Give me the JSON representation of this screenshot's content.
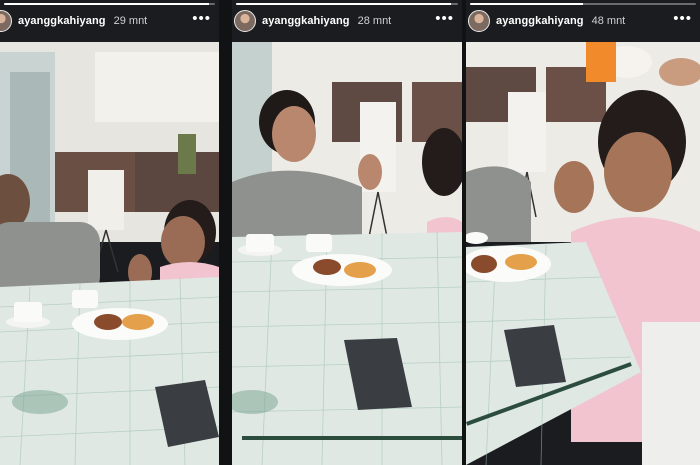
{
  "stories": [
    {
      "username": "ayanggkahiyang",
      "time": "29 mnt",
      "progress": 0.97,
      "menu_icon": "more-dots-icon"
    },
    {
      "username": "ayanggkahiyang",
      "time": "28 mnt",
      "progress": 0.97,
      "menu_icon": "more-dots-icon"
    },
    {
      "username": "ayanggkahiyang",
      "time": "48 mnt",
      "progress": 0.5,
      "menu_icon": "more-dots-icon"
    }
  ],
  "colors": {
    "background": "#111214",
    "table": "#dfe8e3",
    "table_pattern": "#9ebfb1",
    "pink_uniform": "#f2c4cf",
    "grey_shirt": "#8f918e",
    "phone": "#3a3d42"
  }
}
